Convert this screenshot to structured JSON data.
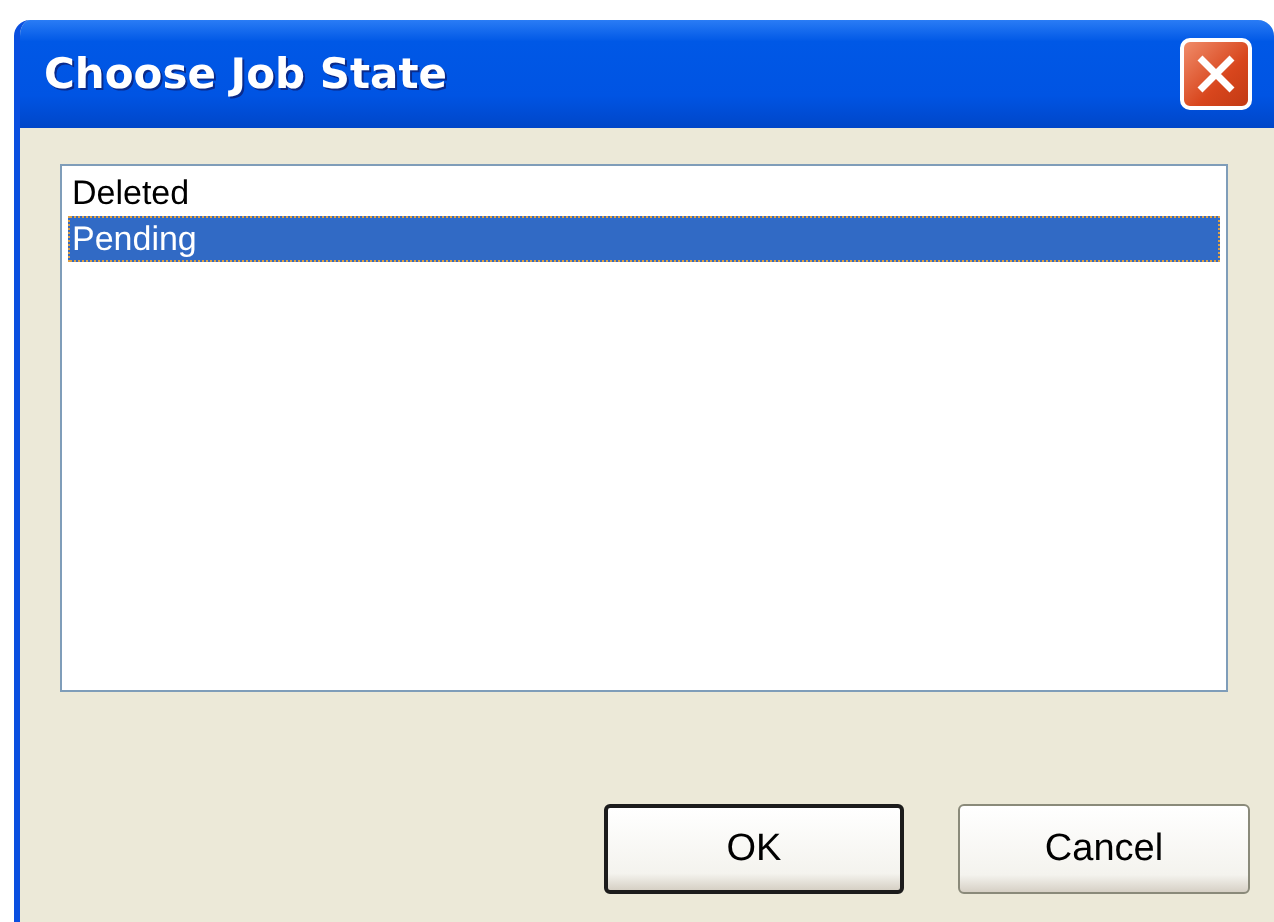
{
  "window": {
    "title": "Choose Job State"
  },
  "list": {
    "items": [
      {
        "label": "Deleted",
        "selected": false
      },
      {
        "label": "Pending",
        "selected": true
      }
    ]
  },
  "buttons": [
    {
      "label": "OK",
      "default": true
    },
    {
      "label": "Cancel",
      "default": false
    }
  ]
}
